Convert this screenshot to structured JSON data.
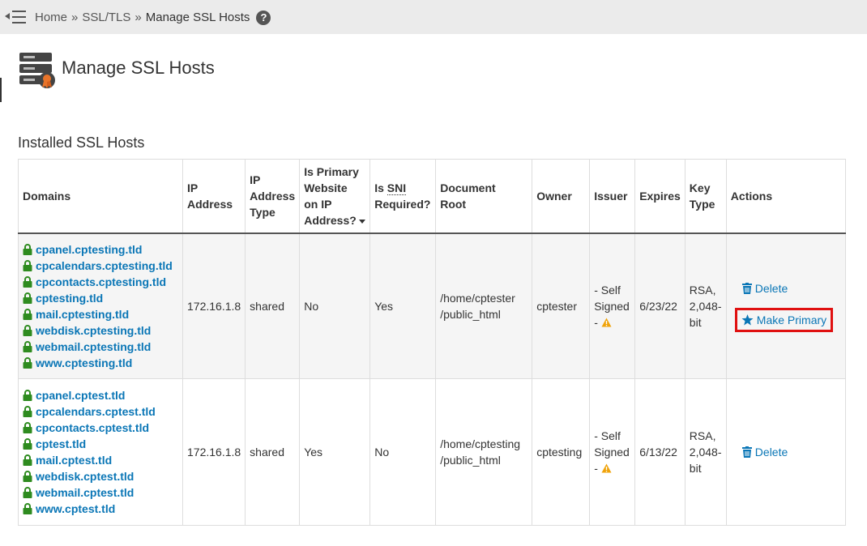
{
  "breadcrumb": {
    "items": [
      "Home",
      "SSL/TLS"
    ],
    "separator": "»",
    "current": "Manage SSL Hosts",
    "help": "?"
  },
  "page": {
    "title": "Manage SSL Hosts",
    "section_title": "Installed SSL Hosts"
  },
  "table": {
    "headers": {
      "domains": "Domains",
      "ip": [
        "IP",
        "Address"
      ],
      "ip_type": [
        "IP",
        "Address",
        "Type"
      ],
      "primary": [
        "Is Primary",
        "Website",
        "on IP",
        "Address?"
      ],
      "sni": [
        "Is ",
        "SNI",
        "Required?"
      ],
      "docroot": [
        "Document",
        "Root"
      ],
      "owner": "Owner",
      "issuer": "Issuer",
      "expires": "Expires",
      "key_type": [
        "Key",
        "Type"
      ],
      "actions": "Actions"
    },
    "rows": [
      {
        "domains": [
          "cpanel.cptesting.tld",
          "cpcalendars.cptesting.tld",
          "cpcontacts.cptesting.tld",
          "cptesting.tld",
          "mail.cptesting.tld",
          "webdisk.cptesting.tld",
          "webmail.cptesting.tld",
          "www.cptesting.tld"
        ],
        "ip": "172.16.1.8",
        "ip_type": "shared",
        "primary": "No",
        "sni": "Yes",
        "docroot": [
          "/home/cptester",
          "/public_html"
        ],
        "owner": "cptester",
        "issuer": [
          "- Self",
          "Signed",
          "- "
        ],
        "expires": "6/23/22",
        "key_type": [
          "RSA,",
          "2,048-",
          "bit"
        ],
        "delete_label": "Delete",
        "make_primary_label": "Make Primary"
      },
      {
        "domains": [
          "cpanel.cptest.tld",
          "cpcalendars.cptest.tld",
          "cpcontacts.cptest.tld",
          "cptest.tld",
          "mail.cptest.tld",
          "webdisk.cptest.tld",
          "webmail.cptest.tld",
          "www.cptest.tld"
        ],
        "ip": "172.16.1.8",
        "ip_type": "shared",
        "primary": "Yes",
        "sni": "No",
        "docroot": [
          "/home/cptesting",
          "/public_html"
        ],
        "owner": "cptesting",
        "issuer": [
          "- Self",
          "Signed",
          "- "
        ],
        "expires": "6/13/22",
        "key_type": [
          "RSA,",
          "2,048-",
          "bit"
        ],
        "delete_label": "Delete"
      }
    ]
  },
  "colors": {
    "link": "#0a76b6",
    "lock": "#2e8b1f",
    "warning": "#f0a30a",
    "highlight": "#e01010",
    "topbar": "#ebebeb"
  }
}
